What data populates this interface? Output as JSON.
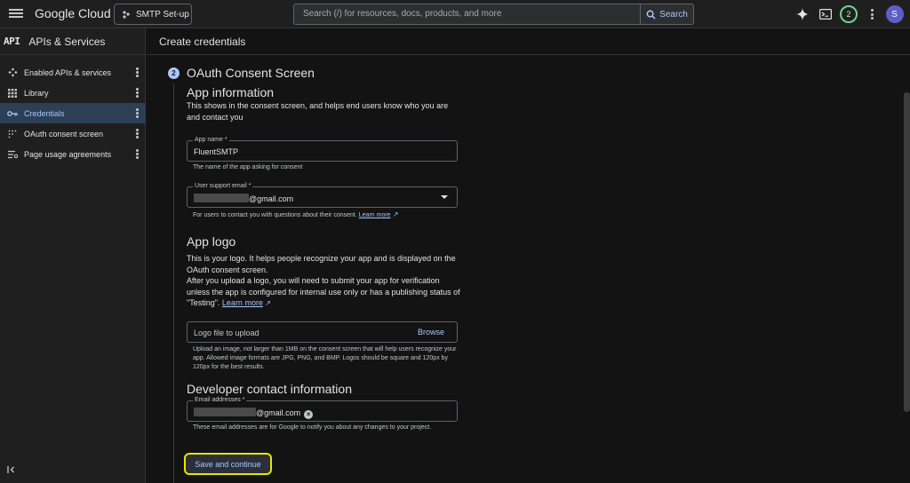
{
  "topbar": {
    "brand_google": "Google",
    "brand_cloud": "Cloud",
    "project_label": "SMTP Set-up",
    "search_placeholder": "Search (/) for resources, docs, products, and more",
    "search_button": "Search",
    "notification_count": "2",
    "avatar_letter": "S"
  },
  "sidebar": {
    "logo": "API",
    "title": "APIs & Services",
    "items": [
      {
        "label": "Enabled APIs & services",
        "icon": "diamond-icon"
      },
      {
        "label": "Library",
        "icon": "grid-icon"
      },
      {
        "label": "Credentials",
        "icon": "key-icon",
        "active": true
      },
      {
        "label": "OAuth consent screen",
        "icon": "dots-grid-icon"
      },
      {
        "label": "Page usage agreements",
        "icon": "settings-list-icon"
      }
    ]
  },
  "main": {
    "page_title": "Create credentials",
    "step_number": "2",
    "step_title": "OAuth Consent Screen",
    "app_info": {
      "heading": "App information",
      "description": "This shows in the consent screen, and helps end users know who you are and contact you",
      "app_name_label": "App name *",
      "app_name_value": "FluentSMTP",
      "app_name_help": "The name of the app asking for consent",
      "support_email_label": "User support email *",
      "support_email_value": "@gmail.com",
      "support_email_help": "For users to contact you with questions about their consent.",
      "learn_more": "Learn more"
    },
    "app_logo": {
      "heading": "App logo",
      "para1": "This is your logo. It helps people recognize your app and is displayed on the OAuth consent screen.",
      "para2": "After you upload a logo, you will need to submit your app for verification unless the app is configured for internal use only or has a publishing status of \"Testing\".",
      "learn_more": "Learn more",
      "upload_placeholder": "Logo file to upload",
      "browse": "Browse",
      "upload_help": "Upload an image, not larger than 1MB on the consent screen that will help users recognize your app. Allowed image formats are JPG, PNG, and BMP. Logos should be square and 120px by 120px for the best results."
    },
    "developer": {
      "heading": "Developer contact information",
      "email_label": "Email addresses *",
      "email_value": "@gmail.com",
      "email_help": "These email addresses are for Google to notify you about any changes to your project."
    },
    "save_button": "Save and continue"
  }
}
